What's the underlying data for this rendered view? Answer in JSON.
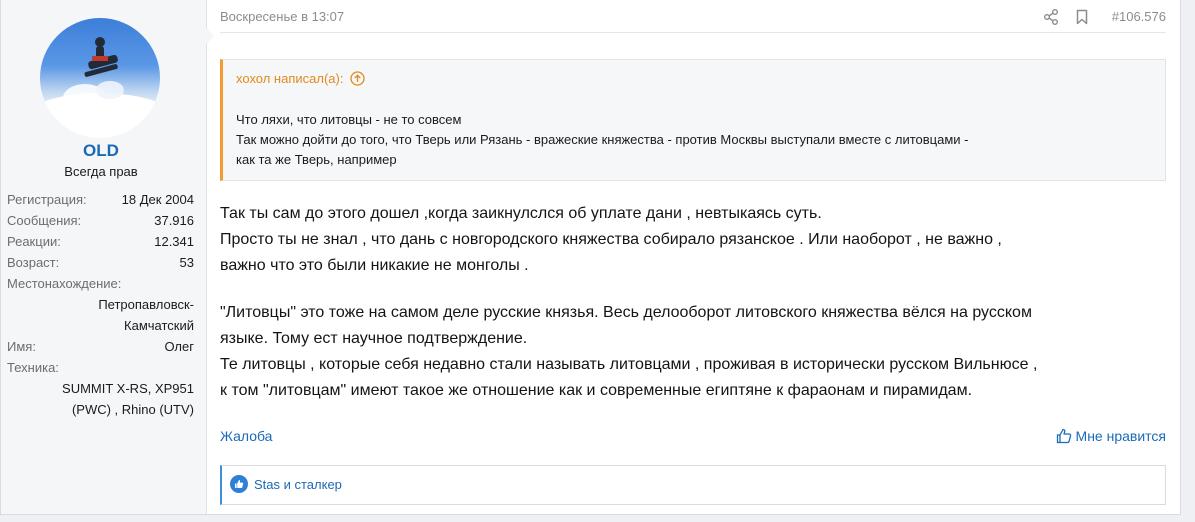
{
  "user": {
    "name": "OLD",
    "title": "Всегда прав",
    "stats": [
      {
        "label": "Регистрация:",
        "value": "18 Дек 2004"
      },
      {
        "label": "Сообщения:",
        "value": "37.916"
      },
      {
        "label": "Реакции:",
        "value": "12.341"
      },
      {
        "label": "Возраст:",
        "value": "53"
      }
    ],
    "location": {
      "label": "Местонахождение:",
      "value_line1": "Петропавловск-",
      "value_line2": "Камчатский"
    },
    "name_field": {
      "label": "Имя:",
      "value": "Олег"
    },
    "tech": {
      "label": "Техника:",
      "value_line1": "SUMMIT X-RS, XP951",
      "value_line2": "(PWC) , Rhino (UTV)"
    }
  },
  "post": {
    "date": "Воскресенье в 13:07",
    "number": "#106.576",
    "quote": {
      "author": "хохол написал(а):",
      "lines": [
        "Что ляхи, что литовцы - не то совсем",
        "Так можно дойти до того, что Тверь или Рязань - вражеские княжества - против Москвы выступали вместе с литовцами -",
        "как та же Тверь, например"
      ]
    },
    "body": [
      "Так ты сам до этого дошел ,когда заикнулслся об уплате дани , невтыкаясь суть.",
      "Просто ты не знал , что дань с новгородского княжества собирало рязанское . Или наоборот , не важно ,",
      "важно что это были никакие не монголы .",
      "\"Литовцы\" это тоже на самом деле русские князья. Весь делооборот литовского княжества вёлся на русском",
      "языке. Тому ест научное подтверждение.",
      "Те литовцы , которые себя недавно стали называть литовцами , проживая в исторически русском Вильнюсе ,",
      "к том \"литовцам\" имеют такое же отношение как и современные египтяне к фараонам и пирамидам."
    ],
    "report_label": "Жалоба",
    "like_label": "Мне нравится",
    "reactions_text": "Stas и сталкер"
  },
  "icons": {
    "share": "share-icon",
    "bookmark": "bookmark-icon",
    "quote_up": "arrow-up-circle-icon",
    "like": "thumbs-up-icon",
    "reaction": "like-reaction-icon"
  },
  "colors": {
    "link": "#1b6ab7",
    "quote_accent": "#f39c34",
    "reaction_bar": "#3d8fd9"
  }
}
